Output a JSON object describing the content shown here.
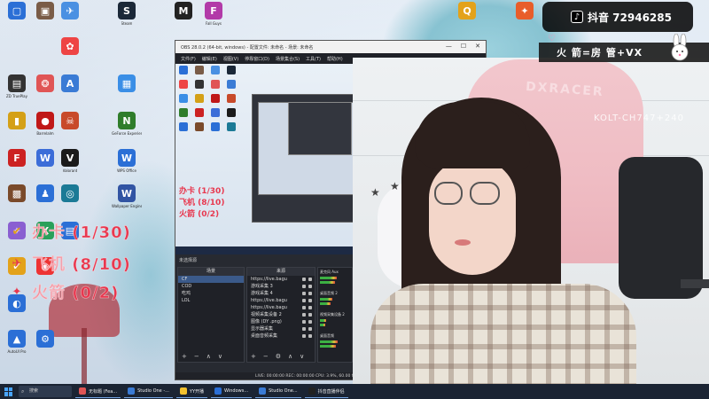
{
  "desktop": {
    "icons": [
      {
        "label": "",
        "color": "#2b6fd6",
        "glyph": "▢"
      },
      {
        "label": "",
        "color": "#7a5c47",
        "glyph": "▣"
      },
      {
        "label": "",
        "color": "#4a90e2",
        "glyph": "✈"
      },
      {
        "label": "Steam",
        "color": "#1b2838",
        "glyph": "S"
      },
      {
        "label": "",
        "color": "#222",
        "glyph": "M"
      },
      {
        "label": "Fall Guys",
        "color": "#b23aa8",
        "glyph": "F"
      },
      {
        "label": "",
        "color": "#e44",
        "glyph": "✿"
      },
      {
        "label": "ZD TruePlay",
        "color": "#333",
        "glyph": "▤"
      },
      {
        "label": "",
        "color": "#e05555",
        "glyph": "❂"
      },
      {
        "label": "",
        "color": "#3a7bd5",
        "glyph": "A"
      },
      {
        "label": "",
        "color": "#3a8ee6",
        "glyph": "▦"
      },
      {
        "label": "",
        "color": "#d4a017",
        "glyph": "▮"
      },
      {
        "label": "Barrelalm",
        "color": "#c01818",
        "glyph": "●"
      },
      {
        "label": "",
        "color": "#c84a2a",
        "glyph": "☠"
      },
      {
        "label": "GeForce Experience",
        "color": "#2f7d2b",
        "glyph": "N"
      },
      {
        "label": "",
        "color": "#c22",
        "glyph": "F"
      },
      {
        "label": "",
        "color": "#3c6dd8",
        "glyph": "W"
      },
      {
        "label": "Valorant",
        "color": "#1b1b1b",
        "glyph": "V"
      },
      {
        "label": "WPS Office",
        "color": "#2b6fd6",
        "glyph": "W"
      },
      {
        "label": "",
        "color": "#7a4a2a",
        "glyph": "▩"
      },
      {
        "label": "",
        "color": "#2b6fd6",
        "glyph": "♟"
      },
      {
        "label": "",
        "color": "#1b7a96",
        "glyph": "◎"
      },
      {
        "label": "Wallpaper Engine",
        "color": "#3154a3",
        "glyph": "W"
      },
      {
        "label": "",
        "color": "#8a5fd1",
        "glyph": "✧"
      },
      {
        "label": "",
        "color": "#2aa05a",
        "glyph": "X"
      },
      {
        "label": "",
        "color": "#2b6fd6",
        "glyph": "▤"
      },
      {
        "label": "",
        "color": "#e3a21a",
        "glyph": "✔"
      },
      {
        "label": "",
        "color": "#e33",
        "glyph": "◉"
      },
      {
        "label": "",
        "color": "#2b6fd6",
        "glyph": "◐"
      },
      {
        "label": "AutoUI Pro",
        "color": "#2b6fd6",
        "glyph": "▲"
      },
      {
        "label": "",
        "color": "#2b6fd6",
        "glyph": "⚙"
      },
      {
        "label": "",
        "color": "#e3a21a",
        "glyph": "Q"
      },
      {
        "label": "",
        "color": "#e85d2a",
        "glyph": "✦"
      }
    ]
  },
  "counters": [
    {
      "icon": "✔",
      "icon_color": "#e3a21a",
      "text": "办卡 (1/30)",
      "text_color": "#e8384f"
    },
    {
      "icon": "✈",
      "icon_color": "#e8384f",
      "text": "飞机 (8/10)",
      "text_color": "#e8384f"
    },
    {
      "icon": "✦",
      "icon_color": "#e8384f",
      "text": "火箭 (0/2)",
      "text_color": "#e8384f"
    }
  ],
  "obs": {
    "title": "OBS 28.0.2 (64-bit, windows) - 配置文件: 未命名 - 场景: 未命名",
    "menu": [
      "文件(F)",
      "编辑(E)",
      "视图(V)",
      "停靠窗口(D)",
      "场景集合(S)",
      "工具(T)",
      "帮助(H)"
    ],
    "no_source": "未选择源",
    "scenes_header": "场景",
    "scenes": [
      "CF",
      "COD",
      "吃鸡",
      "LOL"
    ],
    "sources_header": "来源",
    "sources": [
      "https://live.bagu",
      "游戏采集 3",
      "游戏采集 4",
      "https://live.bagu",
      "https://live.bagu",
      "视频采集设备 2",
      "图像 (DY .png)",
      "显示器采集",
      "桌面音频采集"
    ],
    "mixer": [
      {
        "label": "麦克风 Aux",
        "level": 0.55
      },
      {
        "label": "桌面音频 2",
        "level": 0.4
      },
      {
        "label": "视频采集设备 2",
        "level": 0.2
      },
      {
        "label": "桌面音频",
        "level": 0.6
      }
    ],
    "status": "LIVE: 00:00:00   REC: 00:00:00   CPU: 3.9%, 60.00 fps"
  },
  "taskbar": {
    "search": "搜索",
    "items": [
      {
        "label": "无标题 (Fea...",
        "color": "#e05555"
      },
      {
        "label": "Studio One -...",
        "color": "#3a7bd5"
      },
      {
        "label": "YY开播",
        "color": "#f2c12e"
      },
      {
        "label": "Windows...",
        "color": "#2b6fd6"
      },
      {
        "label": "Studio One...",
        "color": "#3a7bd5"
      },
      {
        "label": "抖音直播伴侣",
        "color": "#222"
      }
    ]
  },
  "overlay": {
    "douyin_label": "抖音 72946285",
    "rank_label": "火 箭=房 管+VX"
  },
  "webcam": {
    "watermark": "KOLT-CH747+240",
    "chair_logo": "DXRACER"
  }
}
